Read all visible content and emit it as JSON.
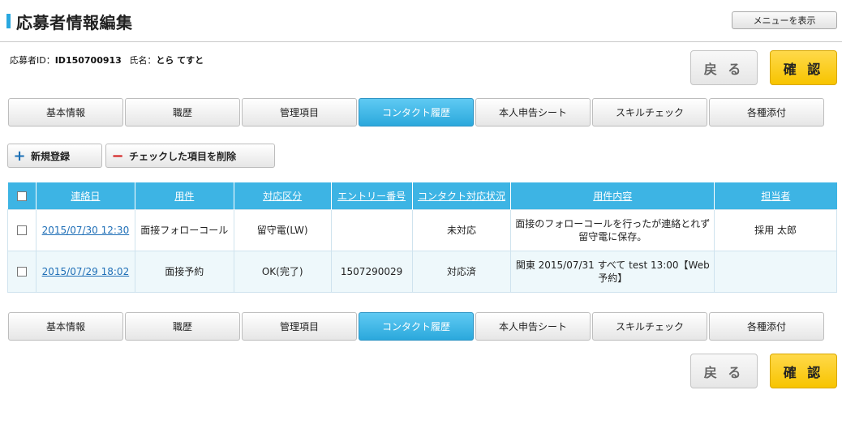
{
  "header": {
    "title": "応募者情報編集",
    "menu_label": "メニューを表示"
  },
  "applicant": {
    "id_label": "応募者ID：",
    "id_value": "ID150700913",
    "name_label": "氏名：",
    "name_value": "とら てすと"
  },
  "buttons": {
    "back": "戻 る",
    "confirm": "確 認",
    "new_register": "新規登録",
    "delete_checked": "チェックした項目を削除"
  },
  "tabs": [
    {
      "label": "基本情報"
    },
    {
      "label": "職歴"
    },
    {
      "label": "管理項目"
    },
    {
      "label": "コンタクト履歴"
    },
    {
      "label": "本人申告シート"
    },
    {
      "label": "スキルチェック"
    },
    {
      "label": "各種添付"
    }
  ],
  "active_tab": "コンタクト履歴",
  "table": {
    "headers": [
      "連絡日",
      "用件",
      "対応区分",
      "エントリー番号",
      "コンタクト対応状況",
      "用件内容",
      "担当者"
    ],
    "rows": [
      {
        "date": "2015/07/30 12:30",
        "subject": "面接フォローコール",
        "category": "留守電(LW)",
        "entry_no": "",
        "status": "未対応",
        "content": "面接のフォローコールを行ったが連絡とれず留守電に保存。",
        "staff": "採用 太郎"
      },
      {
        "date": "2015/07/29 18:02",
        "subject": "面接予約",
        "category": "OK(完了)",
        "entry_no": "1507290029",
        "status": "対応済",
        "content": "関東 2015/07/31 すべて test 13:00【Web予約】",
        "staff": ""
      }
    ]
  },
  "colors": {
    "accent": "#3db4e4",
    "confirm": "#f7c400",
    "link": "#1f6fb7"
  }
}
